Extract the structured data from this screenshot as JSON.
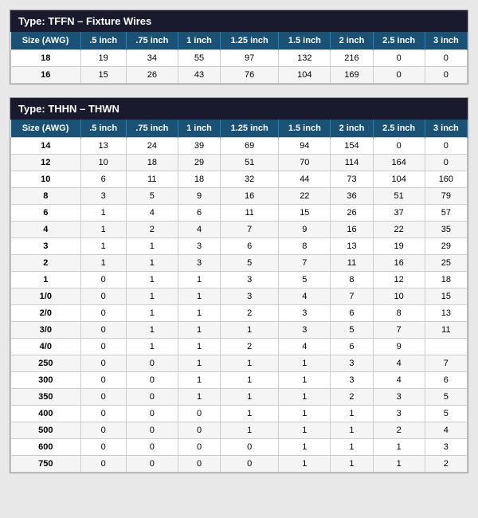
{
  "tffn": {
    "title": "Type: TFFN – Fixture Wires",
    "columns": [
      "Size (AWG)",
      ".5 inch",
      ".75 inch",
      "1 inch",
      "1.25 inch",
      "1.5 inch",
      "2 inch",
      "2.5 inch",
      "3 inch"
    ],
    "rows": [
      [
        "18",
        "19",
        "34",
        "55",
        "97",
        "132",
        "216",
        "0",
        "0"
      ],
      [
        "16",
        "15",
        "26",
        "43",
        "76",
        "104",
        "169",
        "0",
        "0"
      ]
    ]
  },
  "thhn": {
    "title": "Type: THHN – THWN",
    "columns": [
      "Size (AWG)",
      ".5 inch",
      ".75 inch",
      "1 inch",
      "1.25 inch",
      "1.5 inch",
      "2 inch",
      "2.5 inch",
      "3 inch"
    ],
    "rows": [
      [
        "14",
        "13",
        "24",
        "39",
        "69",
        "94",
        "154",
        "0",
        "0"
      ],
      [
        "12",
        "10",
        "18",
        "29",
        "51",
        "70",
        "114",
        "164",
        "0"
      ],
      [
        "10",
        "6",
        "11",
        "18",
        "32",
        "44",
        "73",
        "104",
        "160"
      ],
      [
        "8",
        "3",
        "5",
        "9",
        "16",
        "22",
        "36",
        "51",
        "79"
      ],
      [
        "6",
        "1",
        "4",
        "6",
        "11",
        "15",
        "26",
        "37",
        "57"
      ],
      [
        "4",
        "1",
        "2",
        "4",
        "7",
        "9",
        "16",
        "22",
        "35"
      ],
      [
        "3",
        "1",
        "1",
        "3",
        "6",
        "8",
        "13",
        "19",
        "29"
      ],
      [
        "2",
        "1",
        "1",
        "3",
        "5",
        "7",
        "11",
        "16",
        "25"
      ],
      [
        "1",
        "0",
        "1",
        "1",
        "3",
        "5",
        "8",
        "12",
        "18"
      ],
      [
        "1/0",
        "0",
        "1",
        "1",
        "3",
        "4",
        "7",
        "10",
        "15"
      ],
      [
        "2/0",
        "0",
        "1",
        "1",
        "2",
        "3",
        "6",
        "8",
        "13"
      ],
      [
        "3/0",
        "0",
        "1",
        "1",
        "1",
        "3",
        "5",
        "7",
        "11"
      ],
      [
        "4/0",
        "0",
        "1",
        "1",
        "2",
        "4",
        "6",
        "9"
      ],
      [
        "250",
        "0",
        "0",
        "1",
        "1",
        "1",
        "3",
        "4",
        "7"
      ],
      [
        "300",
        "0",
        "0",
        "1",
        "1",
        "1",
        "3",
        "4",
        "6"
      ],
      [
        "350",
        "0",
        "0",
        "1",
        "1",
        "1",
        "2",
        "3",
        "5"
      ],
      [
        "400",
        "0",
        "0",
        "0",
        "1",
        "1",
        "1",
        "3",
        "5"
      ],
      [
        "500",
        "0",
        "0",
        "0",
        "1",
        "1",
        "1",
        "2",
        "4"
      ],
      [
        "600",
        "0",
        "0",
        "0",
        "0",
        "1",
        "1",
        "1",
        "3"
      ],
      [
        "750",
        "0",
        "0",
        "0",
        "0",
        "1",
        "1",
        "1",
        "2"
      ]
    ]
  }
}
